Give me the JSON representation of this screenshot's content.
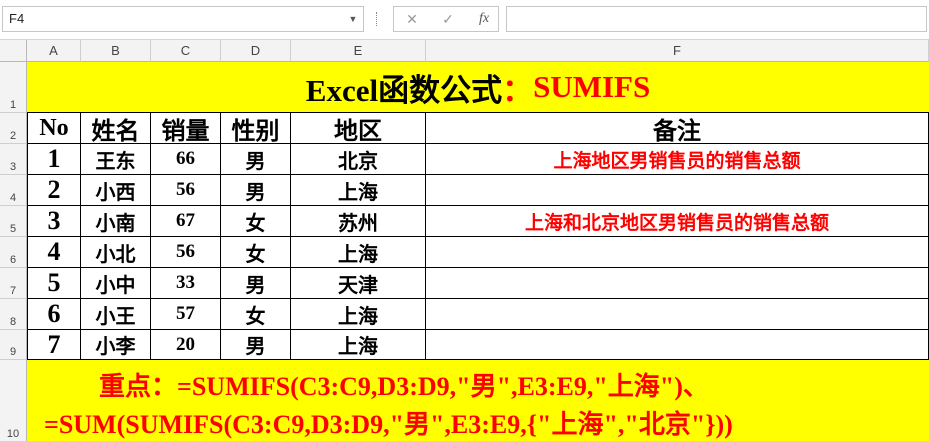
{
  "formula_bar": {
    "name_box": "F4",
    "cancel_icon": "✕",
    "enter_icon": "✓",
    "fx_icon": "fx",
    "formula": ""
  },
  "columns": [
    "A",
    "B",
    "C",
    "D",
    "E",
    "F"
  ],
  "rows": [
    "1",
    "2",
    "3",
    "4",
    "5",
    "6",
    "7",
    "8",
    "9",
    "10"
  ],
  "sheet": {
    "title_black": "Excel函数公式",
    "title_colon": "：",
    "title_red": "SUMIFS",
    "headers": [
      "No",
      "姓名",
      "销量",
      "性别",
      "地区",
      "备注"
    ],
    "data": [
      {
        "no": "1",
        "name": "王东",
        "sales": "66",
        "gender": "男",
        "region": "北京",
        "note": "上海地区男销售员的销售总额"
      },
      {
        "no": "2",
        "name": "小西",
        "sales": "56",
        "gender": "男",
        "region": "上海",
        "note": ""
      },
      {
        "no": "3",
        "name": "小南",
        "sales": "67",
        "gender": "女",
        "region": "苏州",
        "note": "上海和北京地区男销售员的销售总额"
      },
      {
        "no": "4",
        "name": "小北",
        "sales": "56",
        "gender": "女",
        "region": "上海",
        "note": ""
      },
      {
        "no": "5",
        "name": "小中",
        "sales": "33",
        "gender": "男",
        "region": "天津",
        "note": ""
      },
      {
        "no": "6",
        "name": "小王",
        "sales": "57",
        "gender": "女",
        "region": "上海",
        "note": ""
      },
      {
        "no": "7",
        "name": "小李",
        "sales": "20",
        "gender": "男",
        "region": "上海",
        "note": ""
      }
    ],
    "key_label": "重点：",
    "formula_line1": "=SUMIFS(C3:C9,D3:D9,\"男\",E3:E9,\"上海\")、",
    "formula_line2": "=SUM(SUMIFS(C3:C9,D3:D9,\"男\",E3:E9,{\"上海\",\"北京\"}))"
  },
  "colors": {
    "highlight": "#ffff00",
    "accent_red": "#ff0000"
  }
}
